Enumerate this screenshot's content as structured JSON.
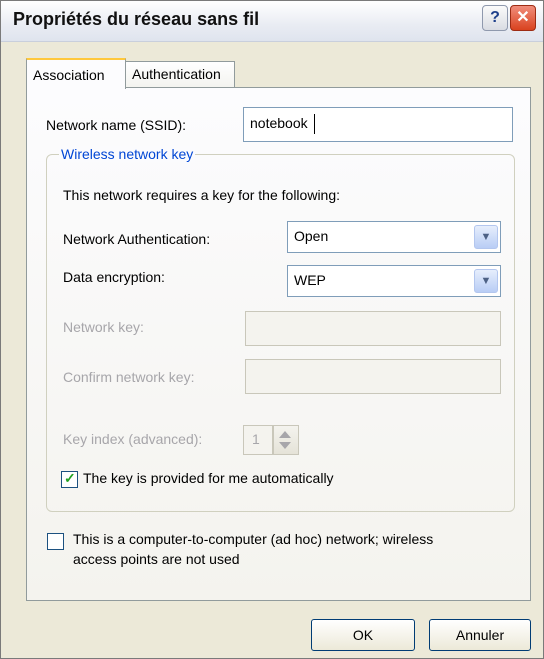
{
  "window": {
    "title": "Propriétés du réseau sans fil",
    "help_label": "?",
    "close_label": "✕"
  },
  "tabs": [
    {
      "label": "Association",
      "active": true
    },
    {
      "label": "Authentication",
      "active": false
    }
  ],
  "association": {
    "ssid_label": "Network name (SSID):",
    "ssid_value": "notebook",
    "group_title": "Wireless network key",
    "requires_text": "This network requires a key for the following:",
    "auth_label": "Network Authentication:",
    "auth_value": "Open",
    "encryption_label": "Data encryption:",
    "encryption_value": "WEP",
    "network_key_label": "Network key:",
    "confirm_key_label": "Confirm network key:",
    "key_index_label": "Key index (advanced):",
    "key_index_value": "1",
    "auto_key_label": "The key is provided for me automatically",
    "auto_key_checked": true,
    "adhoc_line1": "This is a computer-to-computer (ad hoc) network; wireless",
    "adhoc_line2": "access points are not used",
    "adhoc_checked": false
  },
  "buttons": {
    "ok": "OK",
    "cancel": "Annuler"
  },
  "icons": {
    "dropdown": "chevron-down-icon",
    "check": "check-icon"
  },
  "colors": {
    "legend": "#0046d5",
    "active_tab_accent": "#ffc83c",
    "close": "#d9421f"
  }
}
